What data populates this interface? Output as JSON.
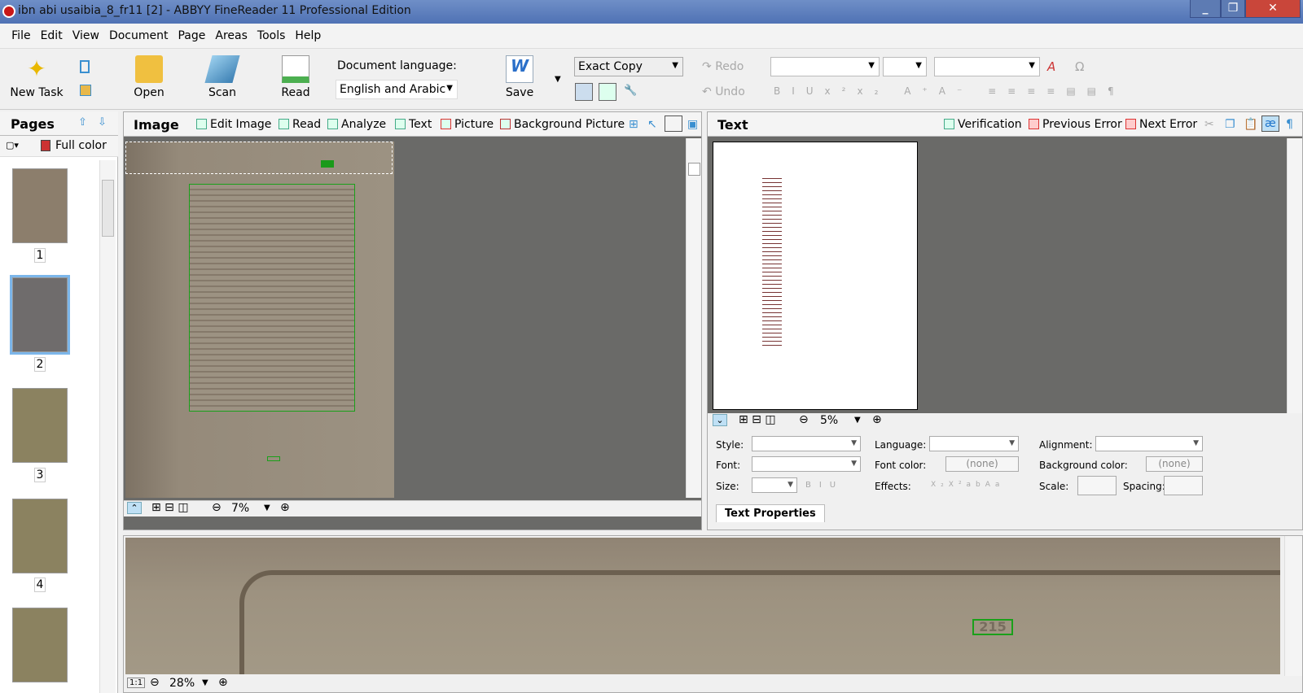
{
  "window": {
    "title": "ibn abi usaibia_8_fr11 [2] - ABBYY FineReader 11 Professional Edition"
  },
  "menu": [
    "File",
    "Edit",
    "View",
    "Document",
    "Page",
    "Areas",
    "Tools",
    "Help"
  ],
  "toolbar": {
    "new_task": "New Task",
    "open": "Open",
    "scan": "Scan",
    "read": "Read",
    "doc_lang_label": "Document language:",
    "doc_lang_value": "English and Arabic",
    "save": "Save",
    "save_mode": "Exact Copy",
    "redo": "Redo",
    "undo": "Undo"
  },
  "pages": {
    "title": "Pages",
    "view_mode": "Full color",
    "items": [
      "1",
      "2",
      "3",
      "4"
    ],
    "selected": "2"
  },
  "image": {
    "title": "Image",
    "tools": [
      "Edit Image",
      "Read",
      "Analyze",
      "Text",
      "Picture",
      "Background Picture"
    ],
    "zoom": "7%"
  },
  "text": {
    "title": "Text",
    "tools": [
      "Verification",
      "Previous Error",
      "Next Error"
    ],
    "zoom": "5%"
  },
  "props": {
    "style": "Style:",
    "font": "Font:",
    "size": "Size:",
    "language": "Language:",
    "font_color": "Font color:",
    "font_color_value": "(none)",
    "effects": "Effects:",
    "alignment": "Alignment:",
    "bg_color": "Background color:",
    "bg_color_value": "(none)",
    "scale": "Scale:",
    "spacing": "Spacing:",
    "tab": "Text Properties"
  },
  "zoompane": {
    "zoom": "28%",
    "ratio": "1:1",
    "page_number": "215"
  }
}
